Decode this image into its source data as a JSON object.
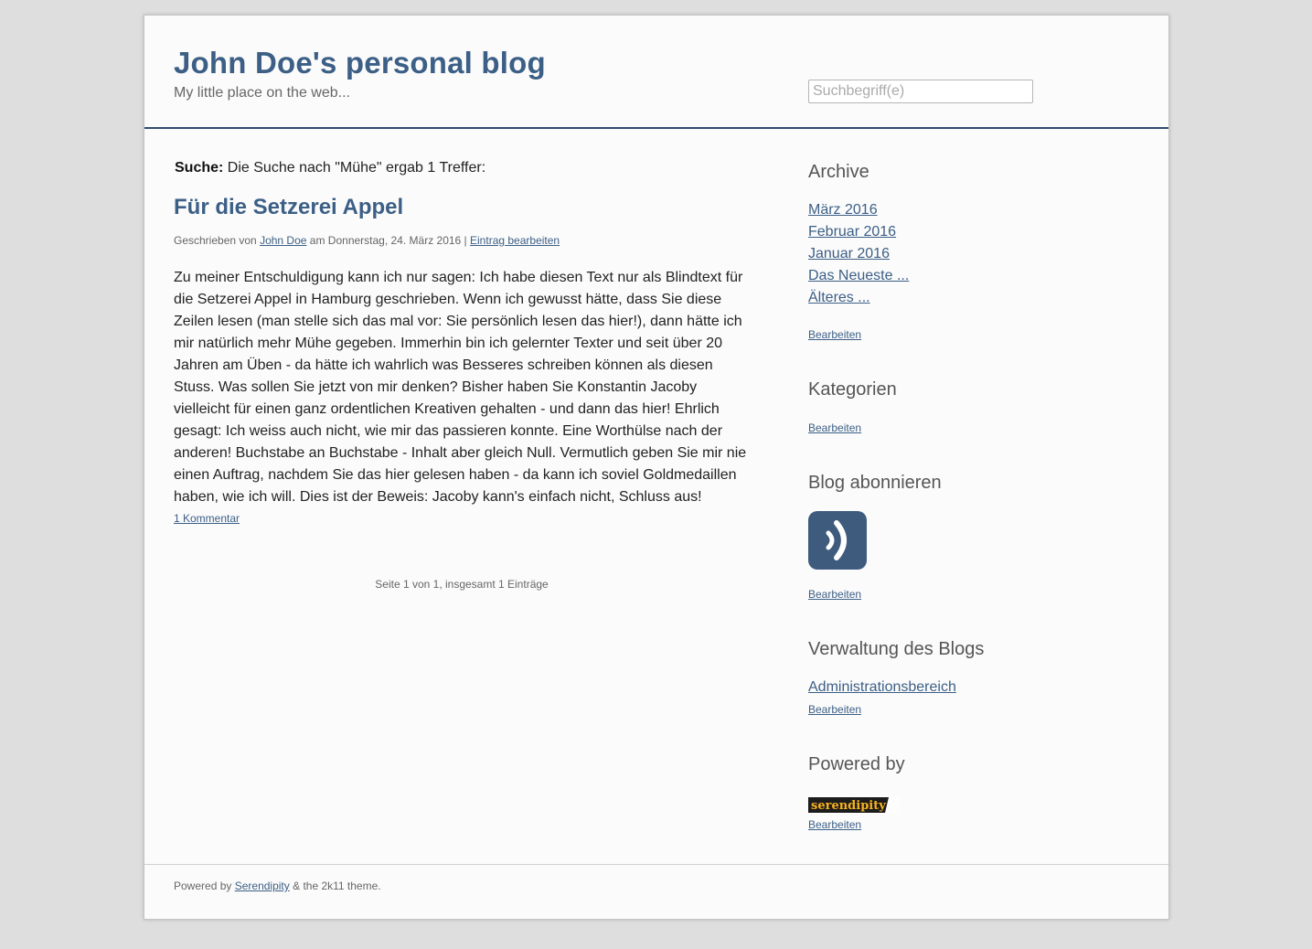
{
  "header": {
    "title": "John Doe's personal blog",
    "tagline": "My little place on the web...",
    "search_placeholder": "Suchbegriff(e)"
  },
  "search": {
    "label": "Suche:",
    "result_text": "Die Suche nach \"Mühe\" ergab 1 Treffer:"
  },
  "post": {
    "title": "Für die Setzerei Appel",
    "meta_prefix": "Geschrieben von",
    "author": "John Doe",
    "meta_date": "am Donnerstag, 24. März 2016 |",
    "edit_label": "Eintrag bearbeiten",
    "body": "Zu meiner Entschuldigung kann ich nur sagen: Ich habe diesen Text nur als Blindtext für die Setzerei Appel in Hamburg geschrieben. Wenn ich gewusst hätte, dass Sie diese Zeilen lesen (man stelle sich das mal vor: Sie persönlich lesen das hier!), dann hätte ich mir natürlich mehr Mühe gegeben. Immerhin bin ich gelernter Texter und seit über 20 Jahren am Üben - da hätte ich wahrlich was Besseres schreiben können als diesen Stuss. Was sollen Sie jetzt von mir denken? Bisher haben Sie Konstantin Jacoby vielleicht für einen ganz ordentlichen Kreativen gehalten - und dann das hier! Ehrlich gesagt: Ich weiss auch nicht, wie mir das passieren konnte. Eine Worthülse nach der anderen! Buchstabe an Buchstabe - Inhalt aber gleich Null. Vermutlich geben Sie mir nie einen Auftrag, nachdem Sie das hier gelesen haben - da kann ich soviel Goldmedaillen haben, wie ich will. Dies ist der Beweis: Jacoby kann's einfach nicht, Schluss aus!",
    "comments_label": "1 Kommentar"
  },
  "pagination": "Seite 1 von 1, insgesamt 1 Einträge",
  "sidebar": {
    "archive": {
      "title": "Archive",
      "links": [
        "März 2016",
        "Februar 2016",
        "Januar 2016",
        "Das Neueste ...",
        "Älteres ..."
      ],
      "edit": "Bearbeiten"
    },
    "categories": {
      "title": "Kategorien",
      "edit": "Bearbeiten"
    },
    "subscribe": {
      "title": "Blog abonnieren",
      "icon": "rss-feed-icon",
      "edit": "Bearbeiten"
    },
    "admin": {
      "title": "Verwaltung des Blogs",
      "link": "Administrationsbereich",
      "edit": "Bearbeiten"
    },
    "powered": {
      "title": "Powered by",
      "logo_text": "serendipity",
      "edit": "Bearbeiten"
    }
  },
  "footer": {
    "prefix": "Powered by",
    "link": "Serendipity",
    "suffix": "& the 2k11 theme."
  },
  "colors": {
    "accent": "#3c5f86",
    "header_rule": "#2f4d6e",
    "background": "#dedede",
    "page": "#fbfbfb",
    "rss_tile": "#3e5b7e",
    "logo_yellow": "#f7b21d"
  }
}
